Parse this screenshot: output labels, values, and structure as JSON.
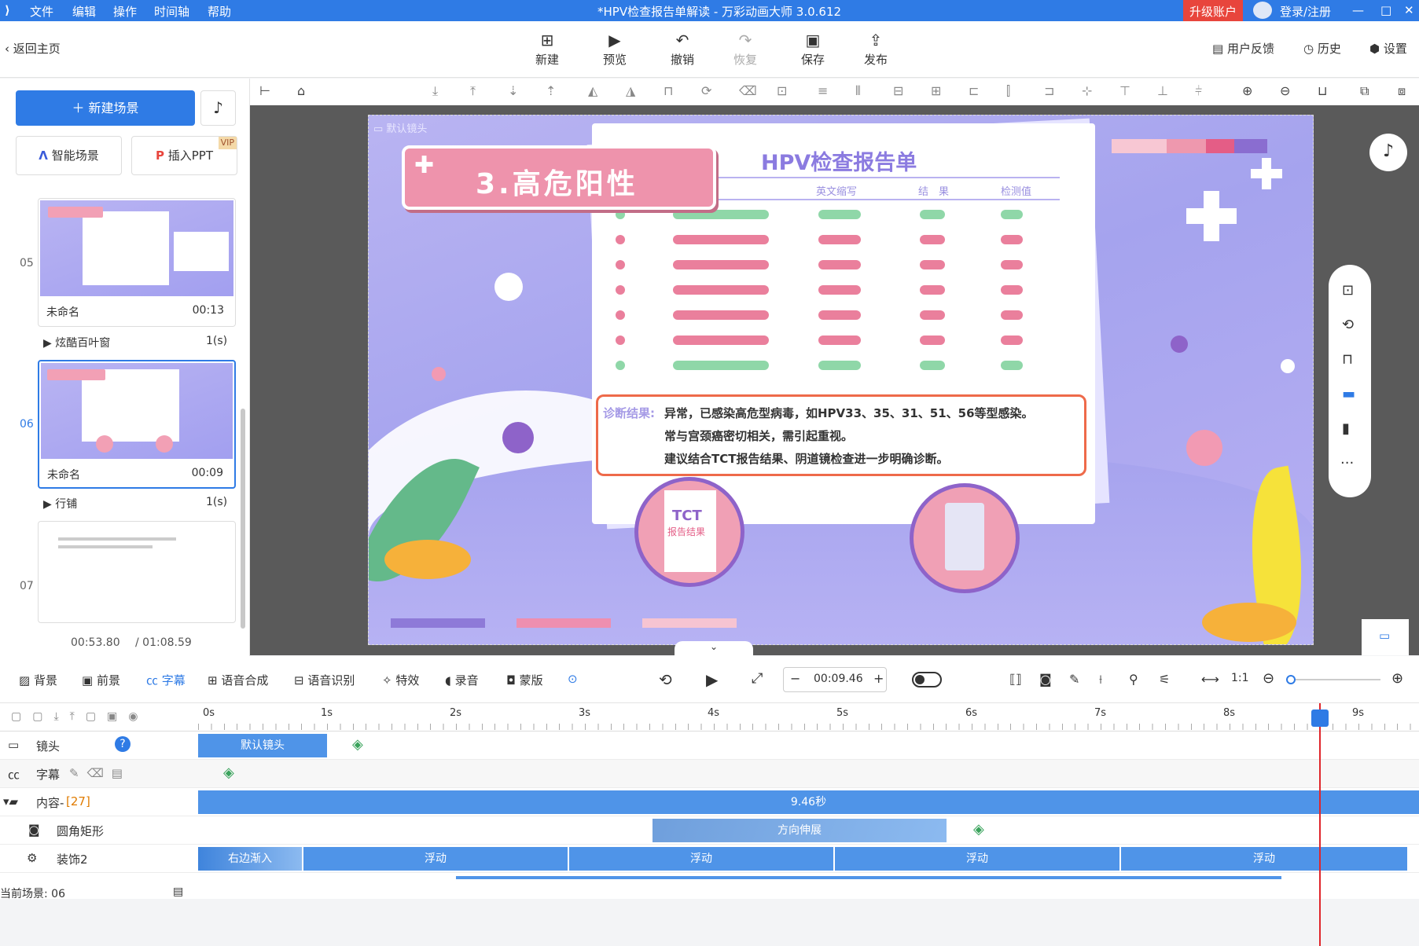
{
  "menu": {
    "items": [
      "文件",
      "编辑",
      "操作",
      "时间轴",
      "帮助"
    ],
    "title": "*HPV检查报告单解读 - 万彩动画大师 3.0.612",
    "upgrade": "升级账户",
    "login": "登录/注册"
  },
  "toolbar": {
    "back": "返回主页",
    "new": "新建",
    "preview": "预览",
    "undo": "撤销",
    "redo": "恢复",
    "save": "保存",
    "publish": "发布",
    "feedback": "用户反馈",
    "history": "历史",
    "settings": "设置"
  },
  "left": {
    "new_scene": "新建场景",
    "smart_scene": "智能场景",
    "insert_ppt": "插入PPT",
    "vip": "VIP",
    "scenes": [
      {
        "num": "05",
        "name": "未命名",
        "time": "00:13",
        "trans": "炫酷百叶窗",
        "trans_time": "1(s)"
      },
      {
        "num": "06",
        "name": "未命名",
        "time": "00:09",
        "trans": "行铺",
        "trans_time": "1(s)"
      },
      {
        "num": "07"
      }
    ],
    "current_time": "00:53.80",
    "total_time": "/ 01:08.59"
  },
  "stage": {
    "camera": "默认镜头",
    "badge": "3.高危阳性",
    "report_title": "HPV检查报告单",
    "col1": "英文缩写",
    "col2": "结　果",
    "col3": "检测值",
    "diag_label": "诊断结果:",
    "diag1": "异常，已感染高危型病毒，如HPV33、35、31、51、56等型感染。",
    "diag2": "常与宫颈癌密切相关，需引起重视。",
    "diag3": "建议结合TCT报告结果、阴道镜检查进一步明确诊断。",
    "tct1": "TCT",
    "tct2": "报告结果"
  },
  "tltools": {
    "bg": "背景",
    "fg": "前景",
    "subtitle": "字幕",
    "tts": "语音合成",
    "asr": "语音识别",
    "fx": "特效",
    "rec": "录音",
    "mask": "蒙版",
    "time": "00:09.46"
  },
  "ruler": [
    "0s",
    "1s",
    "2s",
    "3s",
    "4s",
    "5s",
    "6s",
    "7s",
    "8s",
    "9s"
  ],
  "tracks": {
    "camera": "镜头",
    "camera_clip": "默认镜头",
    "subtitle": "字幕",
    "content": "内容-",
    "content_count": "[27]",
    "content_clip": "9.46秒",
    "rect": "圆角矩形",
    "rect_clip": "方向伸展",
    "deco": "装饰2",
    "deco_clips": [
      "右边渐入",
      "浮动",
      "浮动",
      "浮动",
      "浮动"
    ]
  },
  "status": "当前场景: 06"
}
